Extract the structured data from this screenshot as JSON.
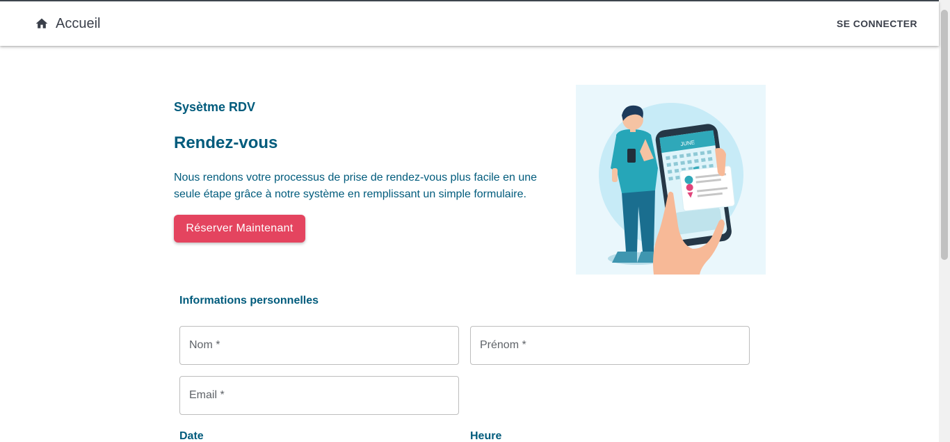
{
  "nav": {
    "home_label": "Accueil",
    "home_icon": "home-icon",
    "login_label": "SE CONNECTER"
  },
  "hero": {
    "brand": "Sysètme RDV",
    "title": "Rendez-vous",
    "description": "Nous rendons votre processus de prise de rendez-vous plus facile en une seule étape grâce à notre système en remplissant un simple formulaire.",
    "cta_label": "Réserver Maintenant",
    "illustration_month": "JUNE"
  },
  "form": {
    "section_title": "Informations personnelles",
    "nom_placeholder": "Nom *",
    "prenom_placeholder": "Prénom *",
    "email_placeholder": "Email *",
    "date_label": "Date",
    "time_label": "Heure"
  },
  "colors": {
    "primary": "#005b7c",
    "accent": "#e4445f",
    "text_dark": "#3a3f4a"
  }
}
